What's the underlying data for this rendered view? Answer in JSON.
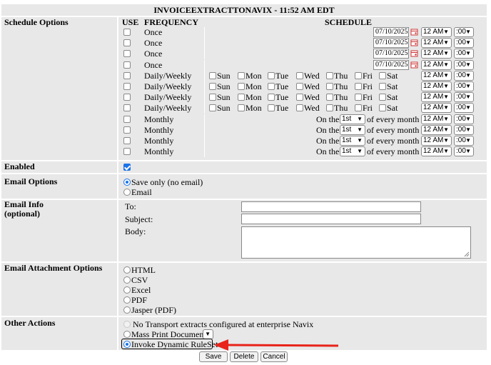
{
  "title": "INVOICEEXTRACTTONAVIX - 11:52 AM EDT",
  "schedule": {
    "label": "Schedule Options",
    "col_use": "USE",
    "col_frequency": "FREQUENCY",
    "col_schedule": "SCHEDULE",
    "days": [
      "Sun",
      "Mon",
      "Tue",
      "Wed",
      "Thu",
      "Fri",
      "Sat"
    ],
    "monthly_prefix": "On the",
    "monthly_suffix": "of every month",
    "rows": [
      {
        "frequency": "Once",
        "kind": "once",
        "date": "07/10/2025",
        "hour": "12 AM",
        "minute": ":00"
      },
      {
        "frequency": "Once",
        "kind": "once",
        "date": "07/10/2025",
        "hour": "12 AM",
        "minute": ":00"
      },
      {
        "frequency": "Once",
        "kind": "once",
        "date": "07/10/2025",
        "hour": "12 AM",
        "minute": ":00"
      },
      {
        "frequency": "Once",
        "kind": "once",
        "date": "07/10/2025",
        "hour": "12 AM",
        "minute": ":00"
      },
      {
        "frequency": "Daily/Weekly",
        "kind": "daily",
        "hour": "12 AM",
        "minute": ":00"
      },
      {
        "frequency": "Daily/Weekly",
        "kind": "daily",
        "hour": "12 AM",
        "minute": ":00"
      },
      {
        "frequency": "Daily/Weekly",
        "kind": "daily",
        "hour": "12 AM",
        "minute": ":00"
      },
      {
        "frequency": "Daily/Weekly",
        "kind": "daily",
        "hour": "12 AM",
        "minute": ":00"
      },
      {
        "frequency": "Monthly",
        "kind": "monthly",
        "day": "1st",
        "hour": "12 AM",
        "minute": ":00"
      },
      {
        "frequency": "Monthly",
        "kind": "monthly",
        "day": "1st",
        "hour": "12 AM",
        "minute": ":00"
      },
      {
        "frequency": "Monthly",
        "kind": "monthly",
        "day": "1st",
        "hour": "12 AM",
        "minute": ":00"
      },
      {
        "frequency": "Monthly",
        "kind": "monthly",
        "day": "1st",
        "hour": "12 AM",
        "minute": ":00"
      }
    ]
  },
  "enabled": {
    "label": "Enabled",
    "checked": true
  },
  "email_options": {
    "label": "Email Options",
    "options": [
      {
        "label": "Save only (no email)",
        "selected": true
      },
      {
        "label": "Email",
        "selected": false
      }
    ]
  },
  "email_info": {
    "label_line1": "Email Info",
    "label_line2": "(optional)",
    "to_label": "To:",
    "subject_label": "Subject:",
    "body_label": "Body:",
    "to_value": "",
    "subject_value": "",
    "body_value": ""
  },
  "attachment": {
    "label": "Email Attachment Options",
    "options": [
      "HTML",
      "CSV",
      "Excel",
      "PDF",
      "Jasper (PDF)"
    ]
  },
  "other_actions": {
    "label": "Other Actions",
    "options": [
      {
        "label": "No Transport extracts configured at enterprise Navix",
        "selected": false,
        "disabled": true
      },
      {
        "label": "Mass Print Document:",
        "selected": false,
        "disabled": false
      },
      {
        "label": "Invoke Dynamic RuleSet",
        "selected": true,
        "disabled": false
      }
    ],
    "annotation_color": "#e8231a"
  },
  "buttons": {
    "save": "Save",
    "delete": "Delete",
    "cancel": "Cancel"
  },
  "colors": {
    "accent": "#1a73e8",
    "band": "#e8e8e8"
  }
}
